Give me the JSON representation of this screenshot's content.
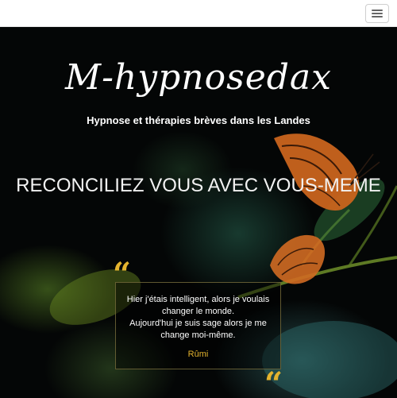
{
  "header": {
    "menu_icon": "hamburger-icon"
  },
  "hero": {
    "brand": "M-hypnosedax",
    "tagline": "Hypnose et thérapies brèves dans les Landes",
    "headline": "RECONCILIEZ VOUS AVEC VOUS-MEME",
    "background_icon": "butterfly-icon",
    "quote": {
      "open_mark": "“",
      "close_mark": "“",
      "lines": [
        "Hier j'étais intelligent, alors je voulais",
        "changer le monde.",
        "Aujourd'hui je suis sage alors je me",
        "change moi-même."
      ],
      "author": "Rûmi"
    }
  },
  "colors": {
    "accent": "#e4b32e",
    "topbar": "#ffffff",
    "hero_background": "#040606"
  }
}
